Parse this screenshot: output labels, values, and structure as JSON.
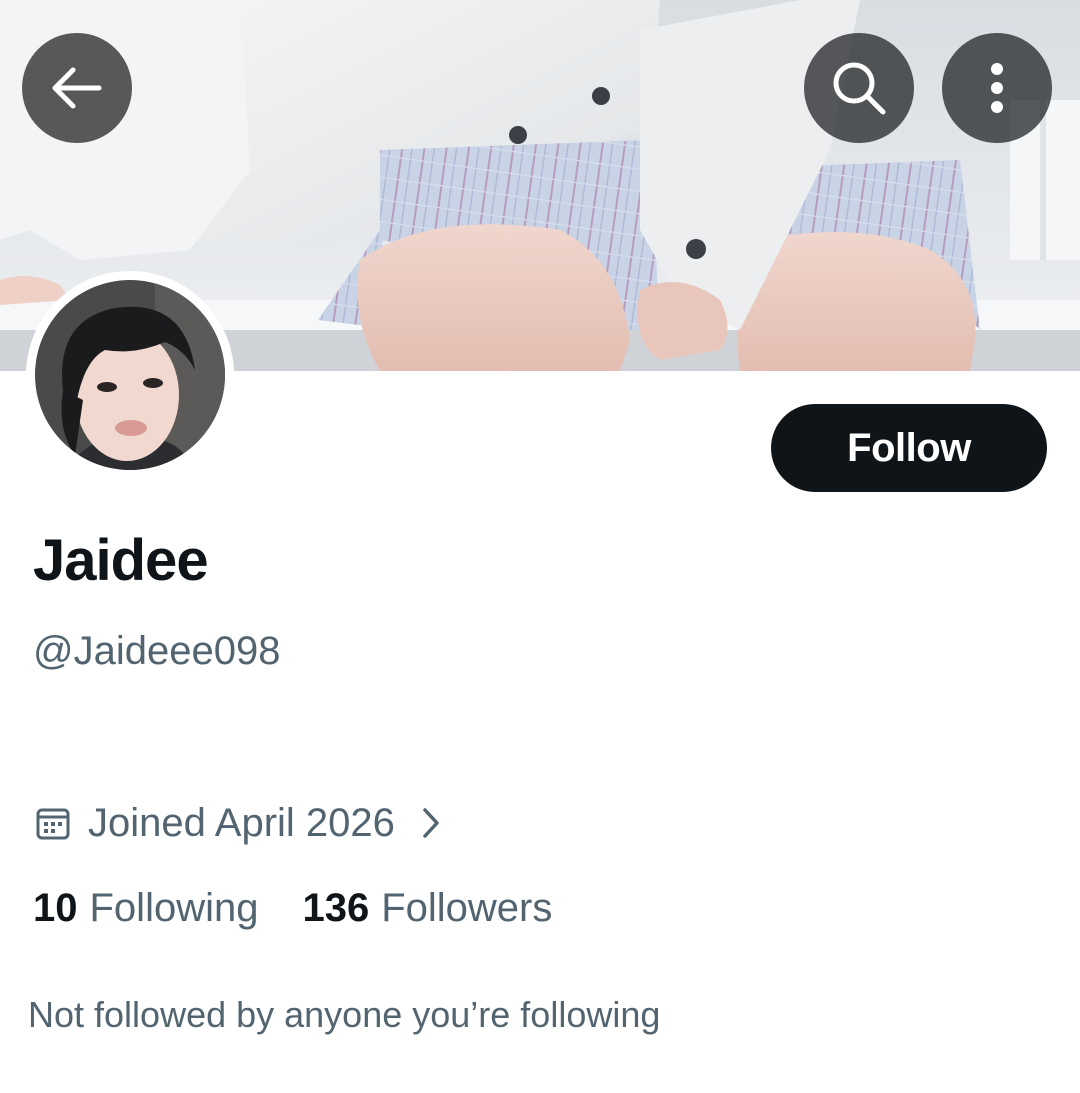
{
  "header": {
    "back_icon": "arrow-left-icon",
    "search_icon": "search-icon",
    "more_icon": "more-vertical-icon"
  },
  "profile": {
    "display_name": "Jaidee",
    "handle": "@Jaideee098",
    "follow_label": "Follow",
    "joined": "Joined April 2026",
    "joined_icon": "calendar-icon",
    "following_count": "10",
    "following_label": "Following",
    "followers_count": "136",
    "followers_label": "Followers",
    "followed_by_text": "Not followed by anyone you’re following"
  },
  "colors": {
    "text_primary": "#0f1419",
    "text_secondary": "#536471",
    "follow_button_bg": "#0f1419",
    "follow_button_text": "#ffffff",
    "header_button_bg": "#1c1f22"
  }
}
